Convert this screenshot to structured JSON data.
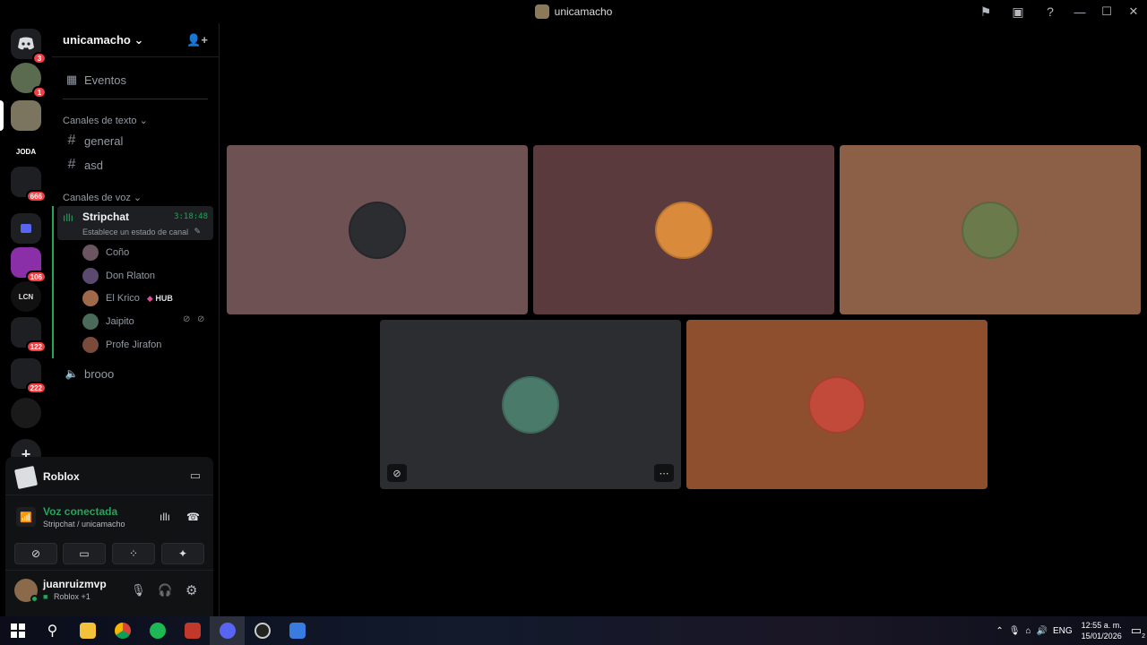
{
  "window": {
    "title": "unicamacho"
  },
  "guilds": [
    {
      "name": "discord-home",
      "badge": "3"
    },
    {
      "name": "server-1",
      "badge": "1"
    },
    {
      "name": "server-unicamacho",
      "badge": ""
    },
    {
      "name": "server-joda",
      "label": "JODA",
      "badge": ""
    },
    {
      "name": "folder-1",
      "badge": "666"
    },
    {
      "name": "folder-blue",
      "badge": ""
    },
    {
      "name": "server-pelado",
      "badge": "106"
    },
    {
      "name": "server-lcn",
      "label": "LCN",
      "badge": ""
    },
    {
      "name": "folder-2",
      "badge": "122"
    },
    {
      "name": "folder-3",
      "badge": "222"
    },
    {
      "name": "server-dark",
      "badge": ""
    }
  ],
  "server": {
    "name": "unicamacho",
    "events_label": "Eventos",
    "text_category": "Canales de texto",
    "text_channels": [
      "general",
      "asd"
    ],
    "voice_category": "Canales de voz",
    "active_voice": {
      "name": "Stripchat",
      "timer": "3:18:48",
      "status": "Establece un estado de canal"
    },
    "members": [
      {
        "name": "Coño",
        "tag": ""
      },
      {
        "name": "Don Rlaton",
        "tag": ""
      },
      {
        "name": "El Krico",
        "tag": "HUB"
      },
      {
        "name": "Jaipito",
        "tag": ""
      },
      {
        "name": "Profe Jirafon",
        "tag": ""
      }
    ],
    "other_voice": "brooo"
  },
  "activity": {
    "game": "Roblox"
  },
  "voice_panel": {
    "status": "Voz conectada",
    "location": "Stripchat / unicamacho"
  },
  "user": {
    "name": "juanruizmvp",
    "status": "Roblox +1"
  },
  "tiles": [
    {
      "name": "tile-1",
      "bg": "#6e5152"
    },
    {
      "name": "tile-2",
      "bg": "#5a3a3d"
    },
    {
      "name": "tile-3",
      "bg": "#8c5f47"
    },
    {
      "name": "tile-4",
      "bg": "#2b2d31"
    },
    {
      "name": "tile-5",
      "bg": "#8d4f2d"
    }
  ],
  "taskbar": {
    "apps": [
      "windows-start",
      "search",
      "file-explorer",
      "chrome",
      "spotify",
      "app-red",
      "discord",
      "obs",
      "roblox-studio"
    ],
    "lang": "ENG",
    "time": "12:55 a. m.",
    "date": "15/01/2026",
    "notifications": "2"
  },
  "colors": {
    "green": "#23a55a",
    "red": "#f23f43",
    "blurple": "#5865f2"
  }
}
